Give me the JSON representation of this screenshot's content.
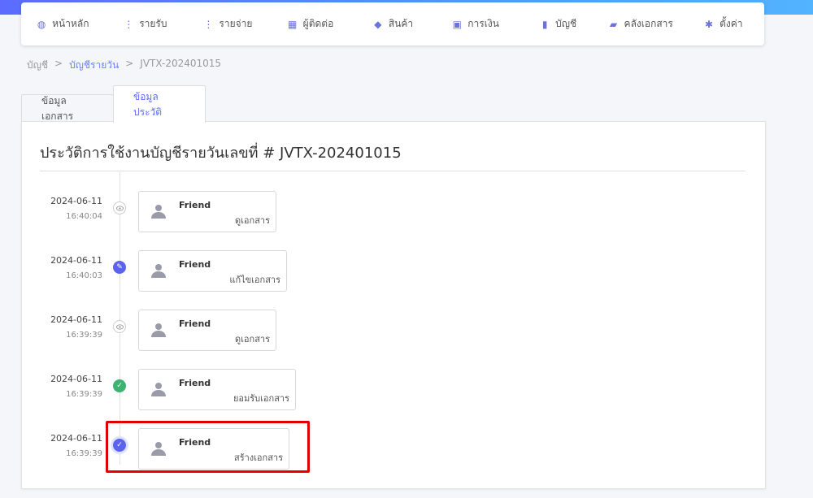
{
  "nav": [
    {
      "label": "หน้าหลัก",
      "icon": "dashboard-icon"
    },
    {
      "label": "รายรับ",
      "icon": "income-icon"
    },
    {
      "label": "รายจ่าย",
      "icon": "expense-icon"
    },
    {
      "label": "ผู้ติดต่อ",
      "icon": "contacts-icon"
    },
    {
      "label": "สินค้า",
      "icon": "box-icon"
    },
    {
      "label": "การเงิน",
      "icon": "money-icon"
    },
    {
      "label": "บัญชี",
      "icon": "book-icon"
    },
    {
      "label": "คลังเอกสาร",
      "icon": "folder-icon"
    },
    {
      "label": "ตั้งค่า",
      "icon": "gear-icon"
    }
  ],
  "breadcrumb": {
    "root": "บัญชี",
    "link": "บัญชีรายวัน",
    "current": "JVTX-202401015",
    "sep": ">"
  },
  "tabs": {
    "info": "ข้อมูลเอกสาร",
    "history": "ข้อมูลประวัติ"
  },
  "card": {
    "title": "ประวัติการใช้งานบัญชีรายวันเลขที่ # JVTX-202401015"
  },
  "history": [
    {
      "date": "2024-06-11",
      "time": "16:40:04",
      "user": "Friend",
      "action": "ดูเอกสาร",
      "type": "view"
    },
    {
      "date": "2024-06-11",
      "time": "16:40:03",
      "user": "Friend",
      "action": "แก้ไขเอกสาร",
      "type": "edit"
    },
    {
      "date": "2024-06-11",
      "time": "16:39:39",
      "user": "Friend",
      "action": "ดูเอกสาร",
      "type": "view"
    },
    {
      "date": "2024-06-11",
      "time": "16:39:39",
      "user": "Friend",
      "action": "ยอมรับเอกสาร",
      "type": "approve"
    },
    {
      "date": "2024-06-11",
      "time": "16:39:39",
      "user": "Friend",
      "action": "สร้างเอกสาร",
      "type": "create"
    }
  ],
  "colors": {
    "accent": "#5b6cff",
    "approve": "#3cb371",
    "highlight": "#e00000"
  }
}
